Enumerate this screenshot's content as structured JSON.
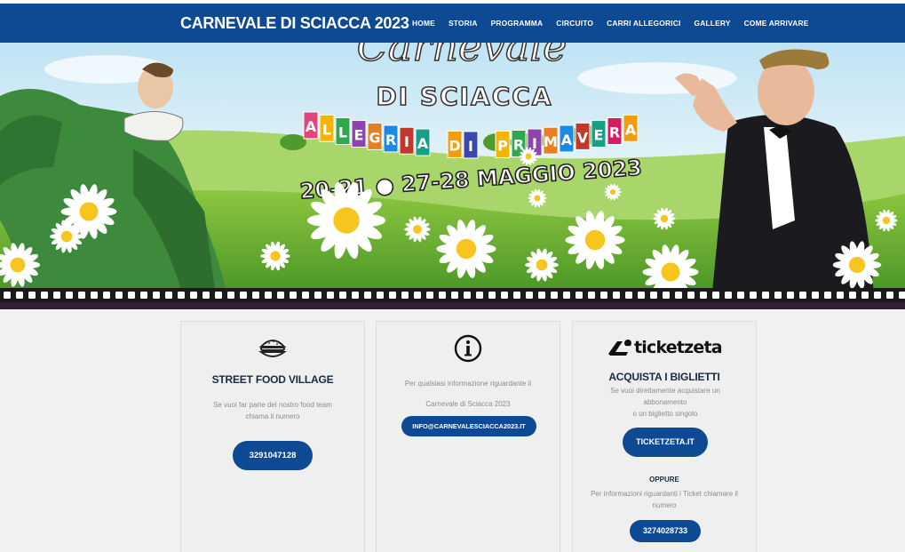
{
  "header": {
    "brand": "CARNEVALE DI SCIACCA 2023",
    "nav": [
      "HOME",
      "STORIA",
      "PROGRAMMA",
      "CIRCUITO",
      "CARRI ALLEGORICI",
      "GALLERY",
      "COME ARRIVARE"
    ]
  },
  "hero": {
    "title_partial": "Carnevale",
    "subtitle": "DI SCIACCA",
    "banner_letters": [
      "A",
      "L",
      "L",
      "E",
      "G",
      "R",
      "I",
      "A",
      " ",
      "D",
      "I",
      " ",
      "P",
      "R",
      "I",
      "M",
      "A",
      "V",
      "E",
      "R",
      "A"
    ],
    "dates": "20-21 ● 27-28 MAGGIO 2023"
  },
  "cards": {
    "food": {
      "icon": "burger-icon",
      "title": "STREET FOOD VILLAGE",
      "text_line1": "Se vuoi far parte del nostro food team",
      "text_line2": "chiama il numero",
      "button": "3291047128"
    },
    "info": {
      "icon": "info-icon",
      "text_line1": "Per qualsiasi informazione riguardante il",
      "text_line2": "Carnevale di Sciacca 2023",
      "button": "INFO@CARNEVALESCIACCA2023.IT"
    },
    "tickets": {
      "logo_text": "ticketzeta",
      "title": "ACQUISTA I BIGLIETTI",
      "text_line1": "Se vuoi direttamente acquistare un",
      "text_line2": "abbonamento",
      "text_line3": "o un biglietto singolo",
      "button": "TICKETZETA.IT",
      "or_label": "OPPURE",
      "phone_text_line1": "Per informazioni riguardanti i Ticket chiamare il",
      "phone_text_line2": "numero",
      "phone_button": "3274028733"
    }
  },
  "colors": {
    "nav_bg": "#0e4a93",
    "button_bg": "#0e4a93",
    "page_bg": "#f1f1f1"
  }
}
